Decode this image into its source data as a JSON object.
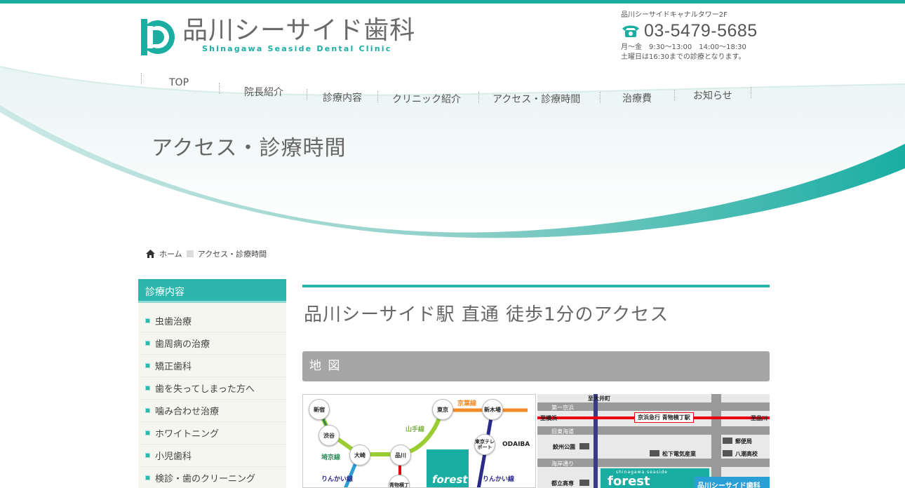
{
  "header": {
    "logo_jp": "品川シーサイド歯科",
    "logo_en": "Shinagawa Seaside Dental Clinic",
    "address": "品川シーサイドキャナルタワー2F",
    "phone": "03-5479-5685",
    "hours_line1": "月～金　9:30～13:00　14:00～18:30",
    "hours_line2": "土曜日は16:30までの診療となります。"
  },
  "nav": {
    "items": [
      {
        "label": "TOP"
      },
      {
        "label": "院長紹介"
      },
      {
        "label": "診療内容"
      },
      {
        "label": "クリニック紹介"
      },
      {
        "label": "アクセス・診療時間"
      },
      {
        "label": "治療費"
      },
      {
        "label": "お知らせ"
      }
    ]
  },
  "page": {
    "heading": "アクセス・診療時間"
  },
  "breadcrumb": {
    "home": "ホーム",
    "current": "アクセス・診療時間"
  },
  "sidebar": {
    "title": "診療内容",
    "items": [
      {
        "label": "虫歯治療"
      },
      {
        "label": "歯周病の治療"
      },
      {
        "label": "矯正歯科"
      },
      {
        "label": "歯を失ってしまった方へ"
      },
      {
        "label": "噛み合わせ治療"
      },
      {
        "label": "ホワイトニング"
      },
      {
        "label": "小児歯科"
      },
      {
        "label": "検診・歯のクリーニング"
      }
    ]
  },
  "main": {
    "title": "品川シーサイド駅 直通 徒歩1分のアクセス",
    "section_title": "地 図"
  },
  "route_map": {
    "stations": [
      "新宿",
      "東京",
      "新木場",
      "渋谷",
      "大崎",
      "品川",
      "東京テレポート",
      "青物横丁"
    ],
    "lines": [
      "京葉線",
      "山手線",
      "埼京線",
      "りんかい線",
      "りんかい線"
    ],
    "odaiba": "ODAIBA",
    "logo": "forest",
    "colors": {
      "yamanote": "#9acd32",
      "saikyo": "#2e8b57",
      "keiyo": "#f08a24",
      "rinkai": "#2a2a8a",
      "keikyu": "#e60012",
      "blue": "#2a9fd6"
    }
  },
  "area_map": {
    "top_label": "至大井町",
    "roads": [
      "第一京浜",
      "旧東海道",
      "海岸通り"
    ],
    "left_label": "至横浜",
    "right_label": "至品川",
    "station": "京浜急行 青物横丁駅",
    "landmarks": [
      "鮫州公園",
      "松下電気産業",
      "郵便局",
      "八潮高校",
      "都立高専"
    ],
    "logo": "forest",
    "logo_small": "shinagawa seaside",
    "clinic_badge": "品川シーサイド歯科"
  }
}
